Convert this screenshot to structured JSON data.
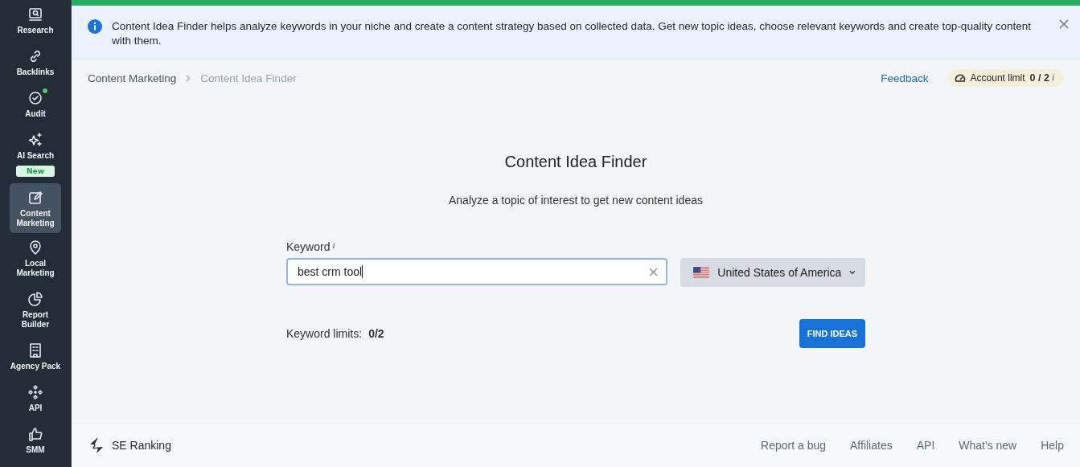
{
  "sidebar": {
    "items": [
      {
        "label": "Research",
        "selected": false,
        "notification": false
      },
      {
        "label": "Backlinks",
        "selected": false,
        "notification": false
      },
      {
        "label": "Audit",
        "selected": false,
        "notification": true
      },
      {
        "label": "AI Search",
        "selected": false,
        "notification": false,
        "badge": "New"
      },
      {
        "label": "Content Marketing",
        "selected": true,
        "notification": false
      },
      {
        "label": "Local Marketing",
        "selected": false,
        "notification": false
      },
      {
        "label": "Report Builder",
        "selected": false,
        "notification": false
      },
      {
        "label": "Agency Pack",
        "selected": false,
        "notification": false
      },
      {
        "label": "API",
        "selected": false,
        "notification": false
      },
      {
        "label": "SMM",
        "selected": false,
        "notification": false
      }
    ]
  },
  "banner": {
    "text": "Content Idea Finder helps analyze keywords in your niche and create a content strategy based on collected data. Get new topic ideas, choose relevant keywords and create top-quality content with them."
  },
  "breadcrumbs": [
    {
      "label": "Content Marketing",
      "current": false
    },
    {
      "label": "Content Idea Finder",
      "current": true
    }
  ],
  "header_actions": {
    "feedback": "Feedback",
    "account_limit_label": "Account limit",
    "account_limit_value": "0 / 2",
    "account_limit_info": "i"
  },
  "main": {
    "title": "Content Idea Finder",
    "subtitle": "Analyze a topic of interest to get new content ideas",
    "keyword_label": "Keyword",
    "keyword_info": "i",
    "keyword_value": "best crm tool",
    "country": "United States of America",
    "limits_label": "Keyword limits:",
    "limits_value": "0/2",
    "button": "FIND IDEAS"
  },
  "footer": {
    "brand": "SE Ranking",
    "links": [
      "Report a bug",
      "Affiliates",
      "API",
      "What's new",
      "Help"
    ]
  }
}
